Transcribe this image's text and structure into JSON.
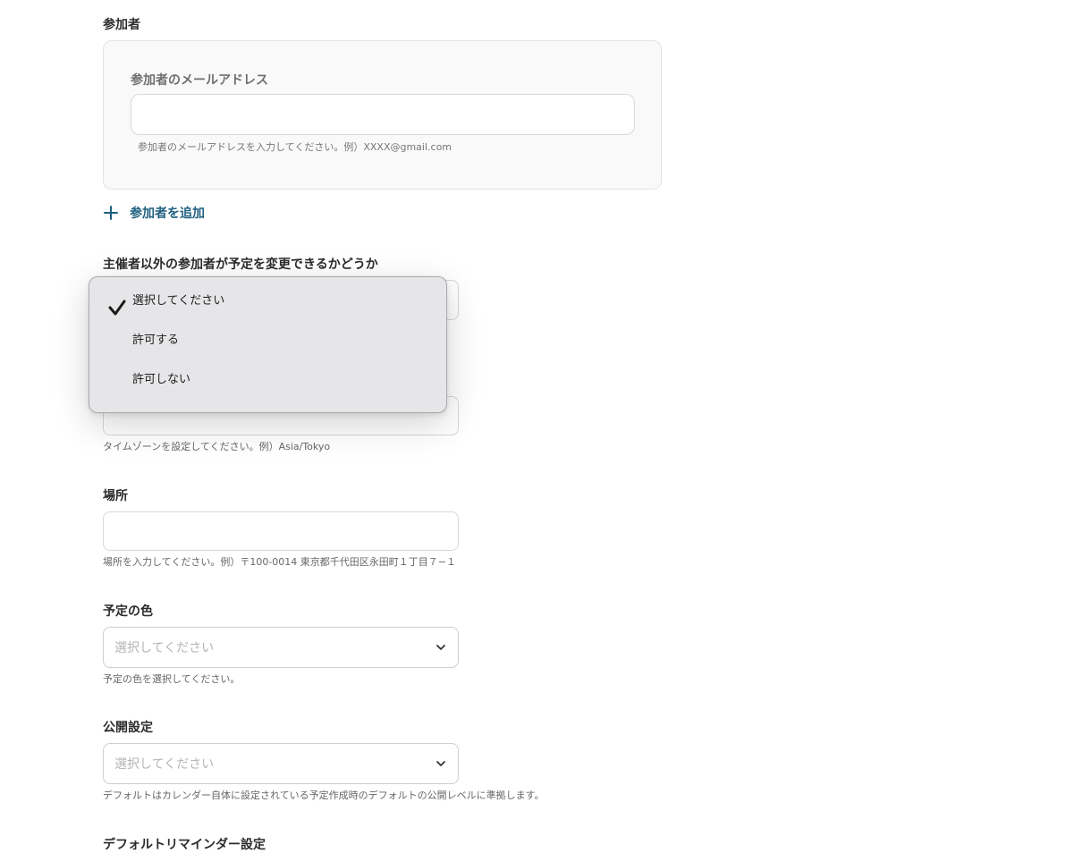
{
  "participants": {
    "label": "参加者",
    "email_label": "参加者のメールアドレス",
    "email_value": "",
    "email_hint": "参加者のメールアドレスを入力してください。例）XXXX@gmail.com",
    "add_label": "参加者を追加"
  },
  "guests_can_modify": {
    "label": "主催者以外の参加者が予定を変更できるかどうか",
    "options": [
      "選択してください",
      "許可する",
      "許可しない"
    ],
    "selected": "選択してください"
  },
  "timezone": {
    "value": "",
    "hint": "タイムゾーンを設定してください。例）Asia/Tokyo"
  },
  "location": {
    "label": "場所",
    "value": "",
    "hint": "場所を入力してください。例）〒100-0014 東京都千代田区永田町１丁目７−１"
  },
  "event_color": {
    "label": "予定の色",
    "placeholder": "選択してください",
    "hint": "予定の色を選択してください。"
  },
  "visibility": {
    "label": "公開設定",
    "placeholder": "選択してください",
    "hint": "デフォルトはカレンダー自体に設定されている予定作成時のデフォルトの公開レベルに準拠します。"
  },
  "default_reminder": {
    "label": "デフォルトリマインダー設定"
  },
  "colors": {
    "accent_link": "#1d5f7f",
    "dropdown_bg": "#e6e6e8"
  },
  "icons": {
    "add": "plus-icon",
    "selected": "checkmark-icon",
    "select_arrow": "chevron-down-icon"
  }
}
